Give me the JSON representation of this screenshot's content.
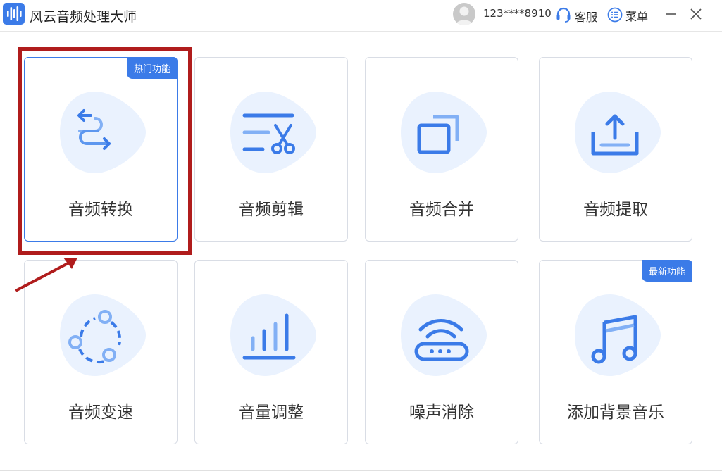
{
  "app": {
    "title": "风云音频处理大师",
    "logo_icon": "waveform-icon"
  },
  "header": {
    "user_phone": "123****8910",
    "service_label": "客服",
    "menu_label": "菜单",
    "minimize_icon": "minimize-icon",
    "close_icon": "close-icon"
  },
  "colors": {
    "accent": "#3b7be8",
    "blob": "#eaf2fe",
    "highlight": "#b01c1c"
  },
  "cards": [
    {
      "label": "音频转换",
      "icon": "convert-arrows-icon",
      "badge": "热门功能"
    },
    {
      "label": "音频剪辑",
      "icon": "scissors-edit-icon"
    },
    {
      "label": "音频合并",
      "icon": "merge-window-icon"
    },
    {
      "label": "音频提取",
      "icon": "upload-extract-icon"
    },
    {
      "label": "音频变速",
      "icon": "speed-cycle-icon"
    },
    {
      "label": "音量调整",
      "icon": "volume-bars-icon"
    },
    {
      "label": "噪声消除",
      "icon": "noise-router-icon"
    },
    {
      "label": "添加背景音乐",
      "icon": "music-note-icon",
      "badge": "最新功能"
    }
  ]
}
